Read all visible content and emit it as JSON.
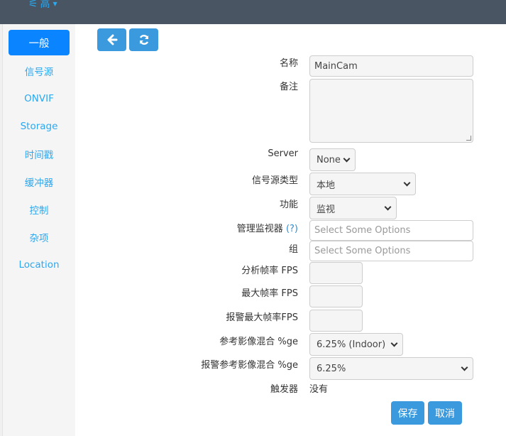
{
  "header": {
    "brand_icon": "broadcast-icon",
    "brand_text": "高"
  },
  "sidebar": {
    "items": [
      {
        "label": "一般",
        "active": true
      },
      {
        "label": "信号源"
      },
      {
        "label": "ONVIF"
      },
      {
        "label": "Storage"
      },
      {
        "label": "时间戳"
      },
      {
        "label": "缓冲器"
      },
      {
        "label": "控制"
      },
      {
        "label": "杂项"
      },
      {
        "label": "Location"
      }
    ]
  },
  "toolbar": {
    "back_icon": "arrow-left-icon",
    "refresh_icon": "refresh-icon"
  },
  "form": {
    "name": {
      "label": "名称",
      "value": "MainCam"
    },
    "notes": {
      "label": "备注",
      "value": ""
    },
    "server": {
      "label": "Server",
      "value": "None"
    },
    "source_type": {
      "label": "信号源类型",
      "value": "本地"
    },
    "function": {
      "label": "功能",
      "value": "监视"
    },
    "manager_monitors": {
      "label": "管理监视器",
      "help": "(?)",
      "placeholder": "Select Some Options"
    },
    "group": {
      "label": "组",
      "placeholder": "Select Some Options"
    },
    "analysis_fps": {
      "label": "分析帧率 FPS",
      "value": ""
    },
    "max_fps": {
      "label": "最大帧率 FPS",
      "value": ""
    },
    "alarm_max_fps": {
      "label": "报警最大帧率FPS",
      "value": ""
    },
    "ref_blend": {
      "label": "参考影像混合 %ge",
      "value": "6.25% (Indoor)"
    },
    "alarm_ref_blend": {
      "label": "报警参考影像混合 %ge",
      "value": "6.25%"
    },
    "triggers": {
      "label": "触发器",
      "value": "没有"
    }
  },
  "actions": {
    "save": "保存",
    "cancel": "取消"
  }
}
